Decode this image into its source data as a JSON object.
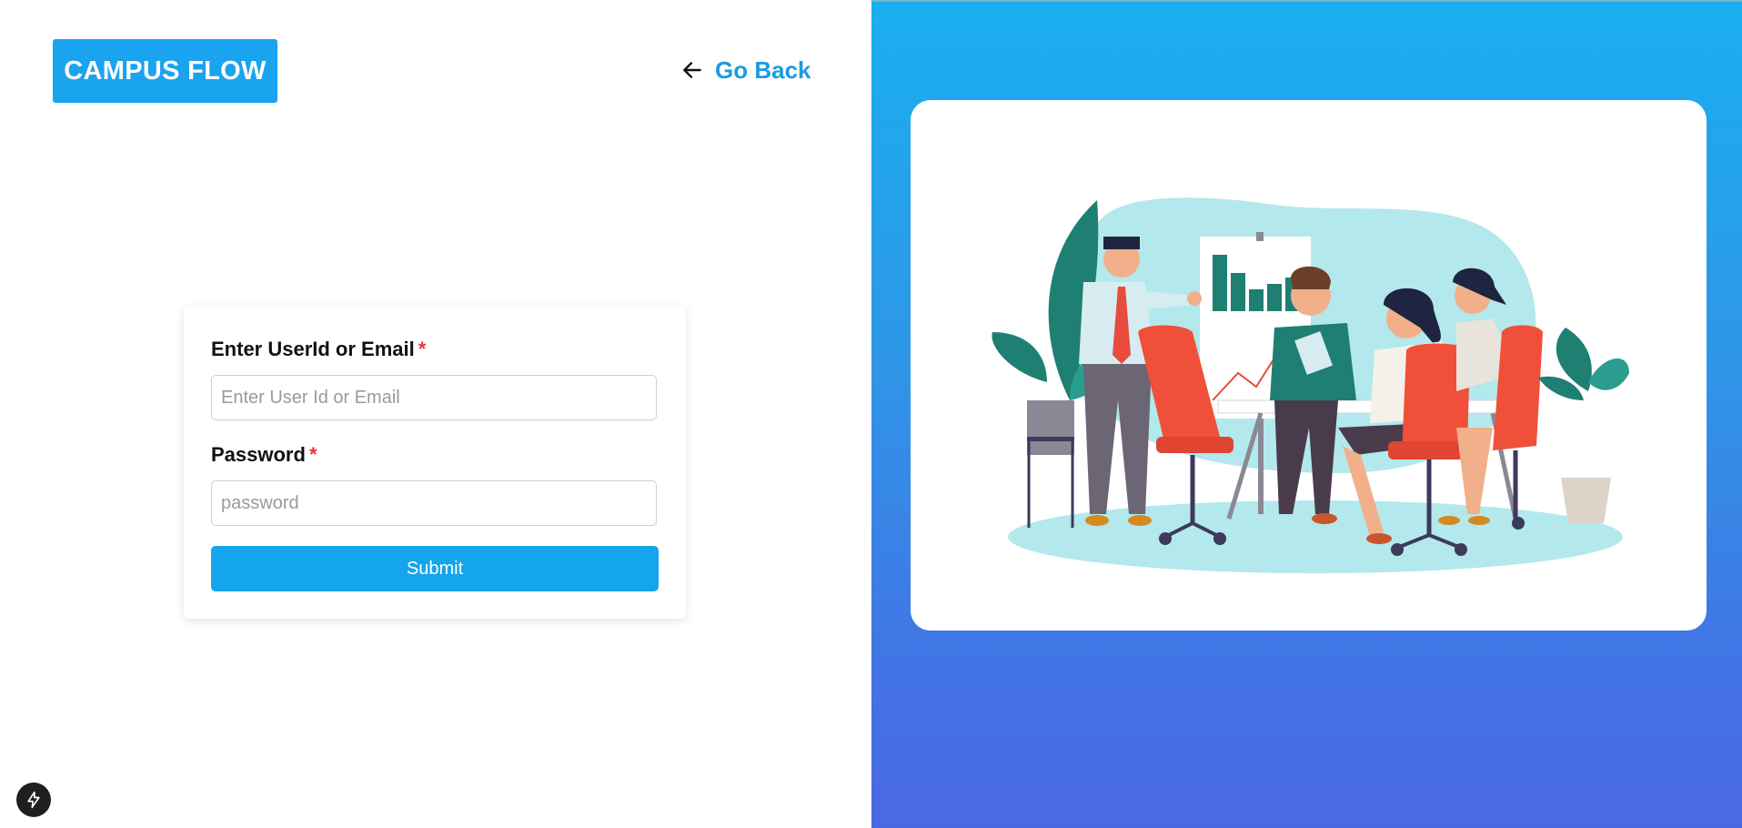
{
  "brand": {
    "logo_text": "CAMPUS FLOW"
  },
  "nav": {
    "go_back_label": "Go Back",
    "go_back_icon": "arrow-left-icon"
  },
  "login_form": {
    "user_label": "Enter UserId or Email",
    "user_required_mark": "*",
    "user_placeholder": "Enter User Id or Email",
    "user_value": "",
    "password_label": "Password",
    "password_required_mark": "*",
    "password_placeholder": "password",
    "password_value": "",
    "submit_label": "Submit"
  },
  "illustration": {
    "icon": "team-meeting-illustration"
  },
  "dev_tools": {
    "icon": "lightning-icon"
  },
  "colors": {
    "brand": "#1aa3ee",
    "link": "#1a9be3",
    "required": "#e53935",
    "submit": "#15a4ee",
    "gradient_top": "#1aaff0",
    "gradient_bottom": "#4a68e3"
  }
}
